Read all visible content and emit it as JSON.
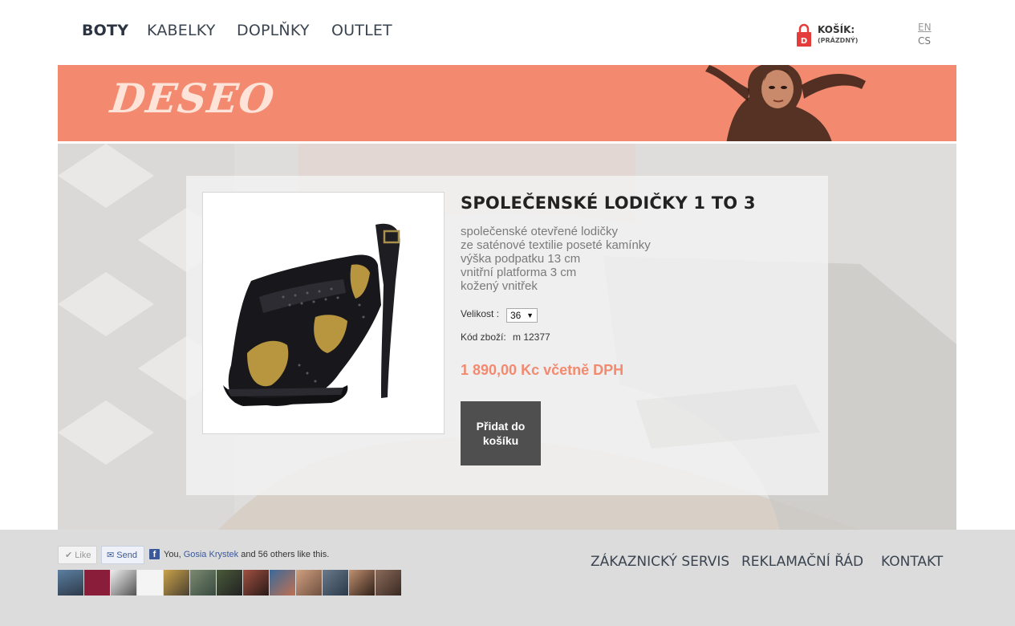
{
  "nav": {
    "items": [
      {
        "label": "BOTY",
        "active": true
      },
      {
        "label": "KABELKY",
        "active": false
      },
      {
        "label": "DOPLŇKY",
        "active": false
      },
      {
        "label": "OUTLET",
        "active": false
      }
    ]
  },
  "cart": {
    "icon_letter": "D",
    "title": "KOŠÍK:",
    "status": "(PRÁZDNÝ)",
    "color": "#e43b3b"
  },
  "languages": [
    {
      "label": "EN"
    },
    {
      "label": "CS"
    }
  ],
  "banner": {
    "logo": "DESEO",
    "color": "#f38a70"
  },
  "product": {
    "title": "SPOLEČENSKÉ LODIČKY 1 TO 3",
    "description": [
      "společenské otevřené lodičky",
      "ze saténové textilie poseté kamínky",
      "výška podpatku 13 cm",
      "vnitřní platforma 3 cm",
      "kožený vnitřek"
    ],
    "size_label": "Velikost :",
    "size_value": "36",
    "code_label": "Kód zboží:",
    "code_value": "m 12377",
    "price": "1 890,00 Kc včetně DPH",
    "add_to_cart_line1": "Přidat do",
    "add_to_cart_line2": "košíku",
    "price_color": "#f38a70"
  },
  "facebook": {
    "like_label": "Like",
    "send_label": "Send",
    "text_before": "You, ",
    "friend_name": "Gosia Krystek",
    "text_after": " and 56 others like this.",
    "avatar_count": 13
  },
  "footer": {
    "links": [
      {
        "label": "ZÁKAZNICKÝ SERVIS"
      },
      {
        "label": "REKLAMAČNÍ ŘÁD"
      },
      {
        "label": "KONTAKT"
      }
    ]
  }
}
